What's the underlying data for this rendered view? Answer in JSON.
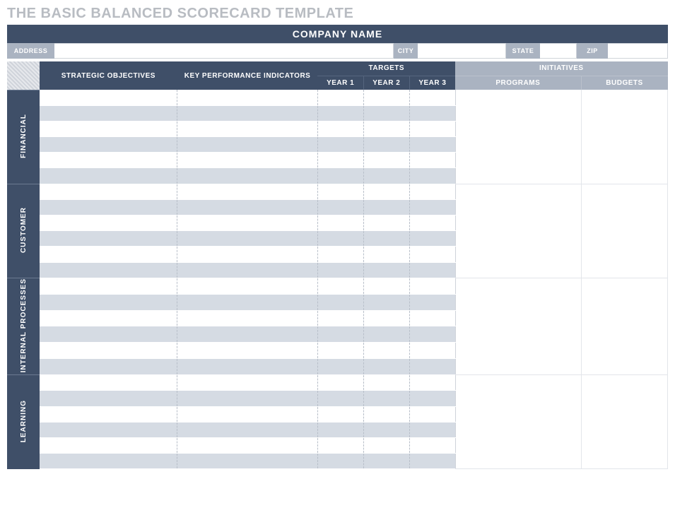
{
  "page_title": "THE BASIC BALANCED SCORECARD TEMPLATE",
  "company_label": "COMPANY NAME",
  "address_labels": {
    "address": "ADDRESS",
    "city": "CITY",
    "state": "STATE",
    "zip": "ZIP"
  },
  "address_values": {
    "address": "",
    "city": "",
    "state": "",
    "zip": ""
  },
  "headers": {
    "strategic_objectives": "STRATEGIC OBJECTIVES",
    "kpi": "KEY PERFORMANCE INDICATORS",
    "targets": "TARGETS",
    "year1": "YEAR 1",
    "year2": "YEAR 2",
    "year3": "YEAR 3",
    "initiatives": "INITIATIVES",
    "programs": "PROGRAMS",
    "budgets": "BUDGETS"
  },
  "perspectives": [
    {
      "label": "FINANCIAL",
      "rows": 6
    },
    {
      "label": "CUSTOMER",
      "rows": 6
    },
    {
      "label": "INTERNAL PROCESSES",
      "rows": 6
    },
    {
      "label": "LEARNING",
      "rows": 6
    }
  ]
}
